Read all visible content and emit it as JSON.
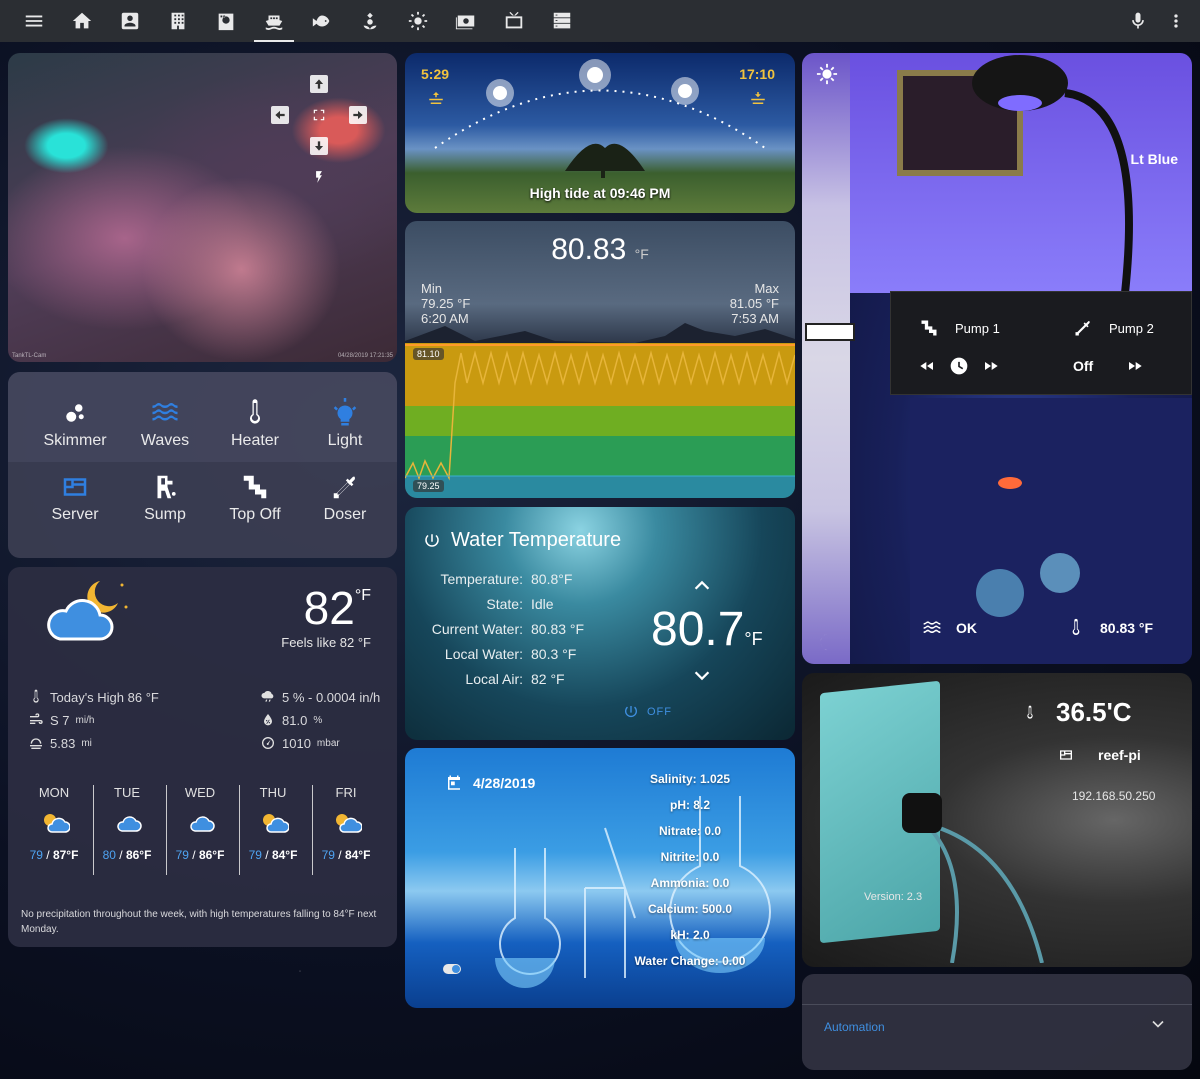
{
  "nav": {
    "icons": [
      "menu-icon",
      "home-icon",
      "account-box-icon",
      "office-building-icon",
      "washing-machine-icon",
      "ferry-icon",
      "fish-icon",
      "flower-icon",
      "brightness-icon",
      "cash-icon",
      "television-icon",
      "server-icon"
    ],
    "active": "ferry-icon",
    "right": [
      "microphone-icon",
      "more-vertical-icon"
    ]
  },
  "camera": {
    "caption_left": "TankTL-Cam",
    "caption_right": "04/28/2019 17:21:35"
  },
  "switches": [
    {
      "label": "Skimmer",
      "icon": "skimmer-icon",
      "color": "#ffffff"
    },
    {
      "label": "Waves",
      "icon": "waves-icon",
      "color": "#2f7fe0"
    },
    {
      "label": "Heater",
      "icon": "thermometer-icon",
      "color": "#ffffff"
    },
    {
      "label": "Light",
      "icon": "lightbulb-icon",
      "color": "#2f7fe0"
    },
    {
      "label": "Server",
      "icon": "server-icon",
      "color": "#2f7fe0"
    },
    {
      "label": "Sump",
      "icon": "water-pump-icon",
      "color": "#ffffff"
    },
    {
      "label": "Top Off",
      "icon": "pipe-icon",
      "color": "#ffffff"
    },
    {
      "label": "Doser",
      "icon": "eyedropper-icon",
      "color": "#ffffff"
    }
  ],
  "weather": {
    "temp": "82",
    "temp_unit": "°F",
    "feels_like": "Feels like 82 °F",
    "high": "Today's High 86 °F",
    "wind": "S 7",
    "wind_unit": "mi/h",
    "visibility": "5.83",
    "visibility_unit": "mi",
    "precip": "5 % - 0.0004 in/h",
    "humidity": "81.0",
    "humidity_unit": "%",
    "pressure": "1010",
    "pressure_unit": "mbar",
    "forecast": [
      {
        "day": "MON",
        "lo": "79",
        "hi": "87°F"
      },
      {
        "day": "TUE",
        "lo": "80",
        "hi": "86°F"
      },
      {
        "day": "WED",
        "lo": "79",
        "hi": "86°F"
      },
      {
        "day": "THU",
        "lo": "79",
        "hi": "84°F"
      },
      {
        "day": "FRI",
        "lo": "79",
        "hi": "84°F"
      }
    ],
    "forecast_sep": " / ",
    "summary": "No precipitation throughout the week, with high temperatures falling to 84°F next Monday."
  },
  "sun": {
    "sunrise": "5:29",
    "sunset": "17:10",
    "tide": "High tide at 09:46 PM"
  },
  "temp_graph": {
    "current": "80.83",
    "unit": "°F",
    "min_label": "Min",
    "min_value": "79.25 °F",
    "min_time": "6:20 AM",
    "max_label": "Max",
    "max_value": "81.05 °F",
    "max_time": "7:53 AM",
    "top_line": "81.10",
    "bottom_line": "79.25"
  },
  "water_temp": {
    "title": "Water Temperature",
    "rows": [
      {
        "k": "Temperature:",
        "v": "80.8°F"
      },
      {
        "k": "State:",
        "v": "Idle"
      },
      {
        "k": "Current Water:",
        "v": "80.83 °F"
      },
      {
        "k": "Local Water:",
        "v": "80.3 °F"
      },
      {
        "k": "Local Air:",
        "v": "82 °F"
      }
    ],
    "setpoint": "80.7",
    "unit": "°F",
    "mode": "OFF"
  },
  "lab": {
    "date": "4/28/2019",
    "values": [
      "Salinity: 1.025",
      "pH: 8.2",
      "Nitrate: 0.0",
      "Nitrite: 0.0",
      "Ammonia: 0.0",
      "Calcium: 500.0",
      "kH: 2.0",
      "Water Change: 0.00"
    ]
  },
  "light": {
    "name": "Lt Blue",
    "pump1": "Pump 1",
    "pump2": "Pump 2",
    "pump2_state": "Off",
    "waves_state": "OK",
    "temp": "80.83 °F"
  },
  "reef": {
    "temp": "36.5'C",
    "name": "reef-pi",
    "ip": "192.168.50.250",
    "version": "Version: 2.3"
  },
  "automation": {
    "label": "Automation"
  }
}
